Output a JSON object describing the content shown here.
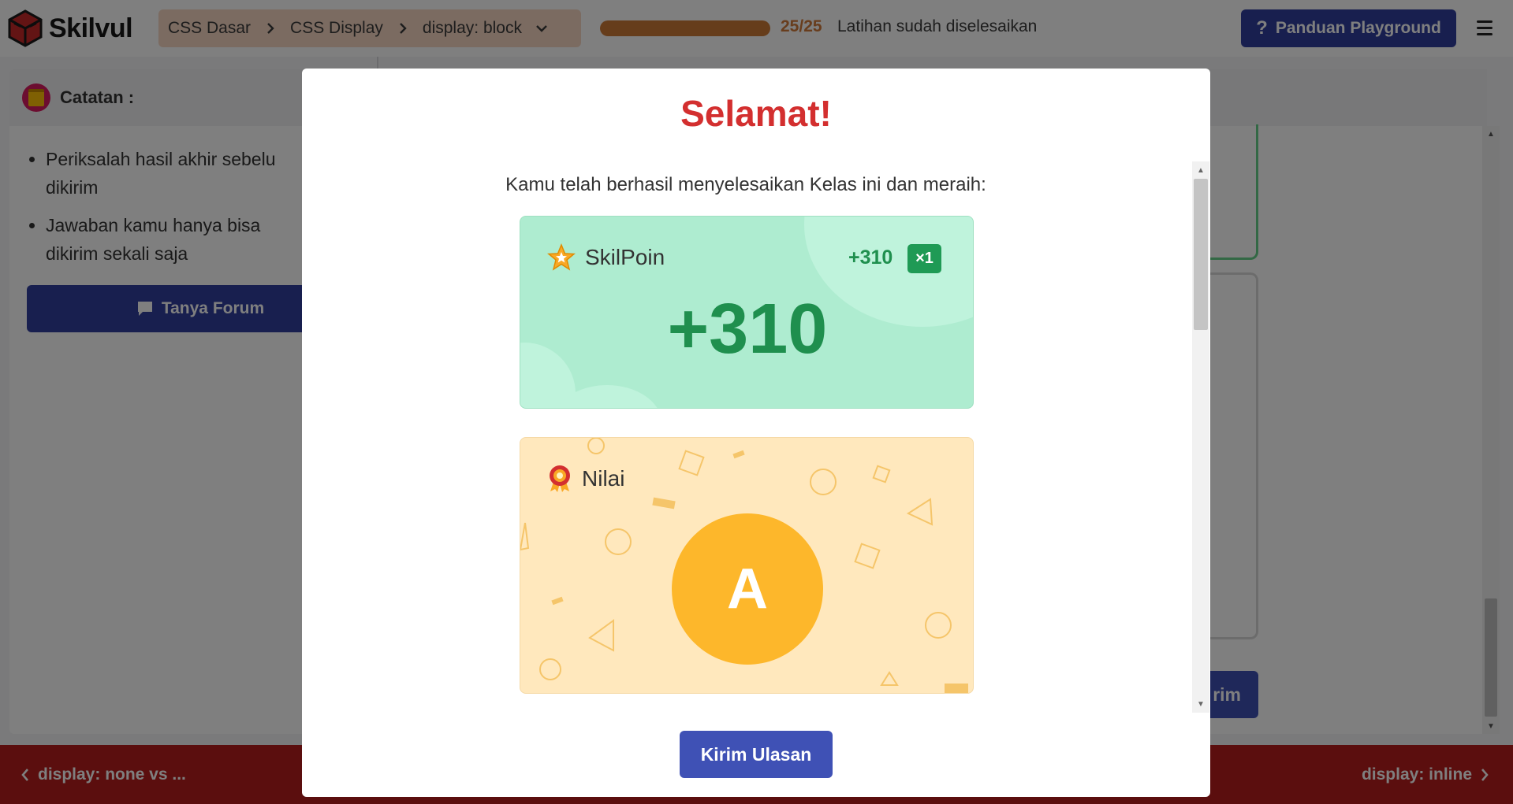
{
  "app": {
    "brand": "Skilvul"
  },
  "breadcrumb": {
    "items": [
      "CSS Dasar",
      "CSS Display",
      "display: block"
    ]
  },
  "progress": {
    "completed": 25,
    "total": 25,
    "fraction": 1.0,
    "count_text": "25/25",
    "status_text": "Latihan sudah diselesaikan"
  },
  "header": {
    "guide_label": "Panduan Playground"
  },
  "notes": {
    "title": "Catatan :",
    "items": [
      "Periksalah hasil akhir sebelu",
      "dikirim",
      "Jawaban kamu hanya bisa",
      "dikirim sekali saja"
    ],
    "forum_label": "Tanya Forum"
  },
  "editor": {
    "send_label_partial": "rim"
  },
  "navigation": {
    "prev_label": "display: none vs ...",
    "next_label": "display: inline"
  },
  "modal": {
    "title": "Selamat!",
    "subtitle": "Kamu telah berhasil menyelesaikan Kelas ini dan meraih:",
    "points_card": {
      "label": "SkilPoin",
      "points_small": "+310",
      "multiplier": "×1",
      "points_big": "+310"
    },
    "grade_card": {
      "label": "Nilai",
      "grade": "A"
    },
    "review_label": "Kirim Ulasan"
  },
  "colors": {
    "brand_red": "#b71c1c",
    "primary_blue": "#303f9f",
    "title_red": "#d32f2f",
    "points_green": "#1f8f4e",
    "points_bg": "#aeecd0",
    "grade_bg": "#ffe8bd",
    "grade_circle": "#fdb72b",
    "progress_orange": "#cc7a36"
  }
}
